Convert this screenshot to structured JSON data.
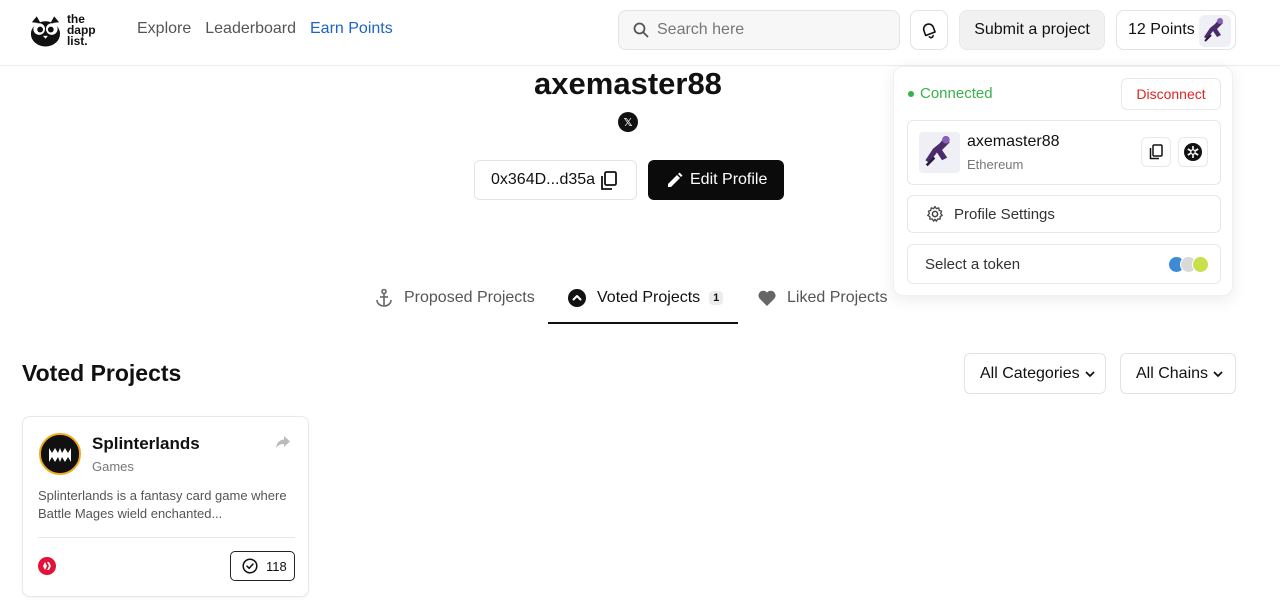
{
  "header": {
    "logo_text": "the dapp list.",
    "nav": [
      {
        "label": "Explore"
      },
      {
        "label": "Leaderboard"
      },
      {
        "label": "Earn Points"
      }
    ],
    "search_placeholder": "Search here",
    "submit_label": "Submit a project",
    "points_label": "12 Points"
  },
  "profile": {
    "username": "axemaster88",
    "social_icon": "x-icon",
    "address": "0x364D...d35a",
    "edit_label": "Edit Profile"
  },
  "tabs": [
    {
      "label": "Proposed Projects",
      "icon": "anchor-icon"
    },
    {
      "label": "Voted Projects",
      "icon": "chevron-up-circle-icon",
      "badge": "1"
    },
    {
      "label": "Liked Projects",
      "icon": "heart-icon"
    }
  ],
  "section": {
    "title": "Voted Projects",
    "filters": [
      {
        "label": "All Categories"
      },
      {
        "label": "All Chains"
      }
    ]
  },
  "cards": [
    {
      "title": "Splinterlands",
      "category": "Games",
      "description": "Splinterlands is a fantasy card game where Battle Mages wield enchanted...",
      "votes": "118"
    }
  ],
  "dropdown": {
    "status": "Connected",
    "disconnect_label": "Disconnect",
    "account_name": "axemaster88",
    "account_chain": "Ethereum",
    "settings_label": "Profile Settings",
    "token_label": "Select a token"
  },
  "colors": {
    "accent": "#1d63c7",
    "connected": "#36b24a",
    "disconnect": "#e02424",
    "primary_button": "#0b0b0b"
  }
}
